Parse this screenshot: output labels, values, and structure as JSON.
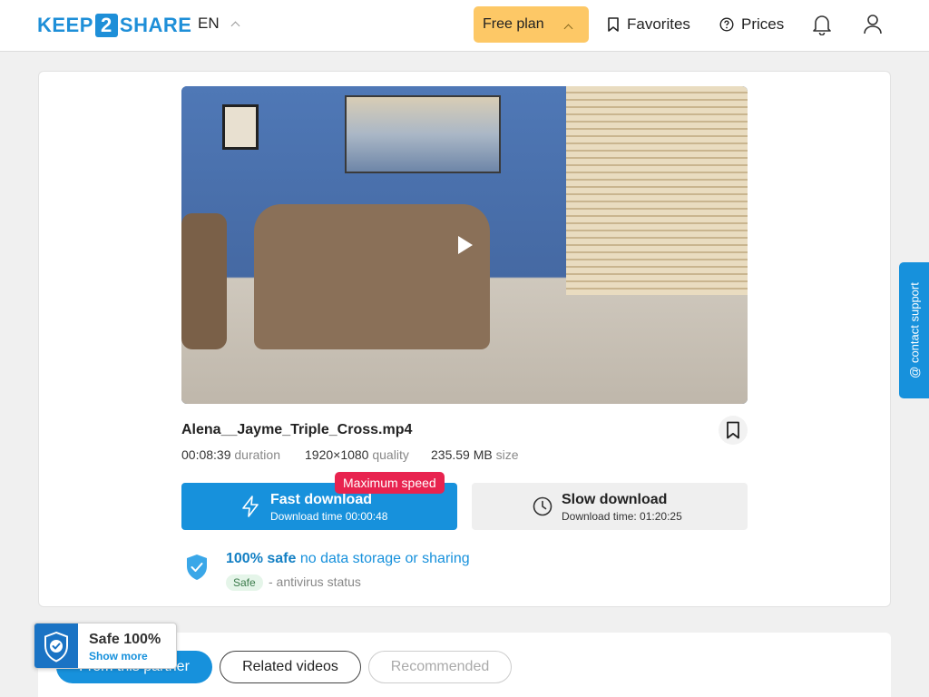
{
  "header": {
    "logo": {
      "left": "KEEP",
      "mid": "2",
      "right": "SHARE"
    },
    "language": "EN",
    "plan_label": "Free plan",
    "favorites_label": "Favorites",
    "prices_label": "Prices"
  },
  "file": {
    "name": "Alena__Jayme_Triple_Cross.mp4",
    "duration": "00:08:39",
    "duration_label": "duration",
    "resolution": "1920×1080",
    "resolution_label": "quality",
    "size": "235.59 MB",
    "size_label": "size"
  },
  "download": {
    "fast_title": "Fast download",
    "fast_time": "Download time 00:00:48",
    "badge": "Maximum speed",
    "slow_title": "Slow download",
    "slow_time": "Download time: 01:20:25"
  },
  "safety": {
    "bold": "100% safe",
    "note": "no data storage or sharing",
    "pill": "Safe",
    "status": "- antivirus status"
  },
  "tabs": [
    "From this partner",
    "Related videos",
    "Recommended"
  ],
  "badge": {
    "title": "Safe 100%",
    "link": "Show more"
  },
  "support_label": "@ contact support",
  "colors": {
    "accent": "#1791dc",
    "plan": "#fdc866",
    "badge_red": "#e8234f"
  }
}
